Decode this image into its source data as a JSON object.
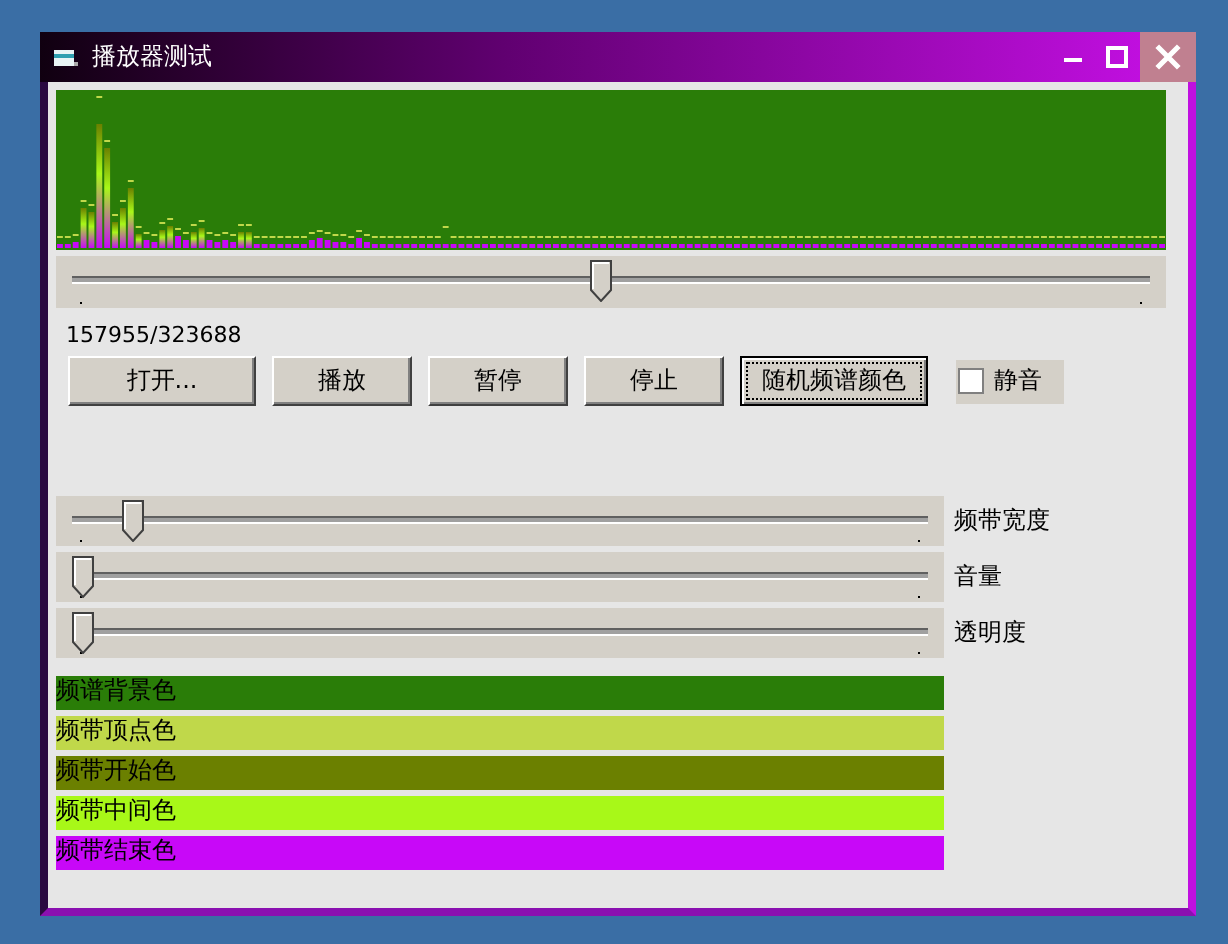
{
  "window": {
    "title": "播放器测试"
  },
  "seek": {
    "level": 0.49
  },
  "position": "157955/323688",
  "buttons": [
    {
      "label": "打开...",
      "focused": false
    },
    {
      "label": "播放",
      "focused": false
    },
    {
      "label": "暂停",
      "focused": false
    },
    {
      "label": "停止",
      "focused": false
    },
    {
      "label": "随机频谱颜色",
      "focused": true
    }
  ],
  "mute": {
    "label": "静音",
    "checked": false
  },
  "sliders": [
    {
      "label": "频带宽度",
      "level": 0.06
    },
    {
      "label": "音量",
      "level": 0
    },
    {
      "label": "透明度",
      "level": 0
    }
  ],
  "colors": [
    {
      "label": "频谱背景色",
      "color": "#2a7d08"
    },
    {
      "label": "频带顶点色",
      "color": "#c0d84a"
    },
    {
      "label": "频带开始色",
      "color": "#6b8000"
    },
    {
      "label": "频带中间色",
      "color": "#a8f818"
    },
    {
      "label": "频带结束色",
      "color": "#c808f8"
    }
  ]
}
